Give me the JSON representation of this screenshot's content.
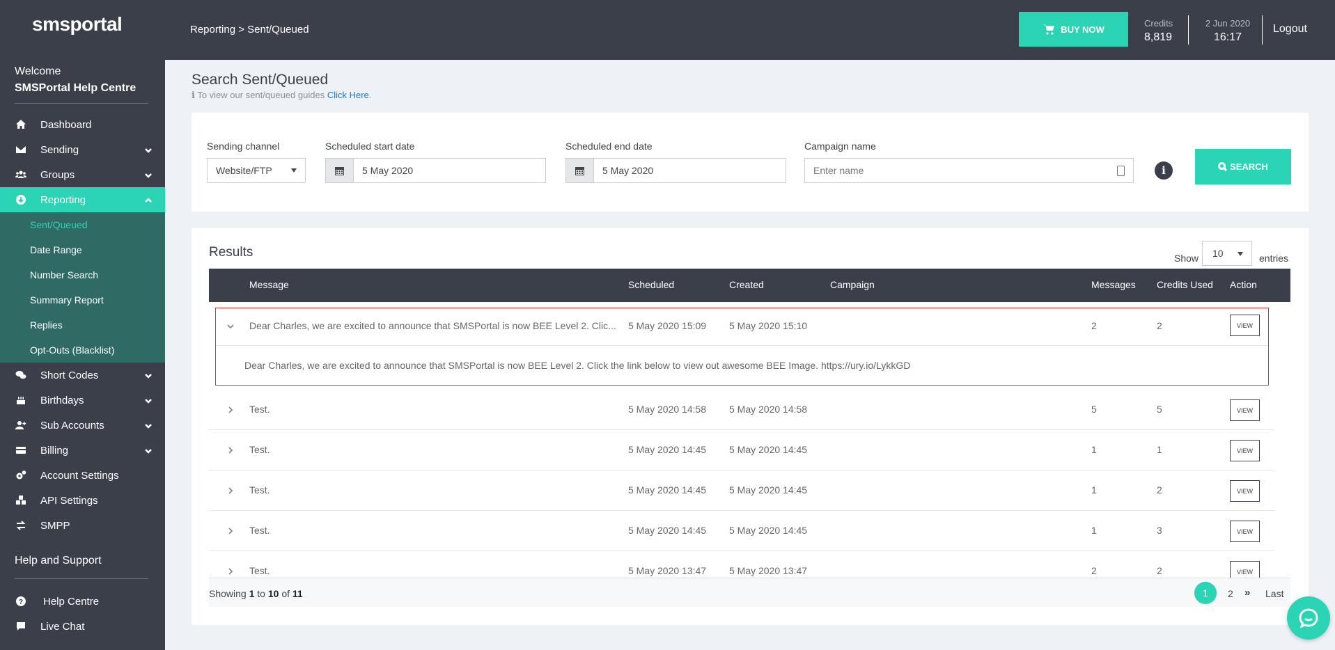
{
  "brand": {
    "logo_text_pre": "sms",
    "logo_text_post": "portal",
    "accent": "#2bd4b4",
    "dark": "#3b3f4a"
  },
  "sidebar": {
    "welcome": "Welcome",
    "account": "SMSPortal Help Centre",
    "items": [
      {
        "label": "Dashboard",
        "icon": "home-icon",
        "has_chevron": false
      },
      {
        "label": "Sending",
        "icon": "envelope-icon",
        "has_chevron": true
      },
      {
        "label": "Groups",
        "icon": "users-icon",
        "has_chevron": true
      },
      {
        "label": "Reporting",
        "icon": "download-icon",
        "has_chevron": true,
        "active": true
      }
    ],
    "reporting_sub": [
      "Sent/Queued",
      "Date Range",
      "Number Search",
      "Summary Report",
      "Replies",
      "Opt-Outs (Blacklist)"
    ],
    "items_after": [
      {
        "label": "Short Codes",
        "icon": "comments-icon",
        "has_chevron": true
      },
      {
        "label": "Birthdays",
        "icon": "cake-icon",
        "has_chevron": true
      },
      {
        "label": "Sub Accounts",
        "icon": "user-plus-icon",
        "has_chevron": true
      },
      {
        "label": "Billing",
        "icon": "credit-card-icon",
        "has_chevron": true
      },
      {
        "label": "Account Settings",
        "icon": "cogs-icon",
        "has_chevron": false
      },
      {
        "label": "API Settings",
        "icon": "cubes-icon",
        "has_chevron": false
      },
      {
        "label": "SMPP",
        "icon": "exchange-icon",
        "has_chevron": false
      }
    ],
    "help_heading": "Help and Support",
    "help_items": [
      {
        "label": "Help Centre",
        "icon": "question-circle-icon"
      },
      {
        "label": "Live Chat",
        "icon": "chat-icon"
      }
    ]
  },
  "topbar": {
    "breadcrumb": "Reporting > Sent/Queued",
    "buy_now": "BUY NOW",
    "credits_label": "Credits",
    "credits_value": "8,819",
    "date": "2 Jun 2020",
    "time": "16:17",
    "logout": "Logout"
  },
  "page": {
    "title": "Search Sent/Queued",
    "guide_text": "To view our sent/queued guides",
    "guide_link": "Click Here",
    "guide_dot": "."
  },
  "filters": {
    "channel_label": "Sending channel",
    "channel_value": "Website/FTP",
    "start_label": "Scheduled start date",
    "start_value": "5 May 2020",
    "end_label": "Scheduled end date",
    "end_value": "5 May 2020",
    "campaign_label": "Campaign name",
    "campaign_placeholder": "Enter name",
    "search_button": "SEARCH"
  },
  "results": {
    "title": "Results",
    "show_label": "Show",
    "show_value": "10",
    "entries_label": "entries",
    "columns": [
      "Message",
      "Scheduled",
      "Created",
      "Campaign",
      "Messages",
      "Credits Used",
      "Action"
    ],
    "view_label": "VIEW",
    "expanded_full_message": "Dear Charles, we are excited to announce that SMSPortal is now BEE Level 2. Click the link below to view out awesome BEE Image. https://ury.io/LykkGD",
    "rows": [
      {
        "message": "Dear Charles, we are excited to announce that SMSPortal is now BEE Level 2. Clic...",
        "scheduled": "5 May 2020 15:09",
        "created": "5 May 2020 15:10",
        "campaign": "",
        "messages": "2",
        "credits": "2",
        "expanded": true
      },
      {
        "message": "Test.",
        "scheduled": "5 May 2020 14:58",
        "created": "5 May 2020 14:58",
        "campaign": "",
        "messages": "5",
        "credits": "5"
      },
      {
        "message": "Test.",
        "scheduled": "5 May 2020 14:45",
        "created": "5 May 2020 14:45",
        "campaign": "",
        "messages": "1",
        "credits": "1"
      },
      {
        "message": "Test.",
        "scheduled": "5 May 2020 14:45",
        "created": "5 May 2020 14:45",
        "campaign": "",
        "messages": "1",
        "credits": "2"
      },
      {
        "message": "Test.",
        "scheduled": "5 May 2020 14:45",
        "created": "5 May 2020 14:45",
        "campaign": "",
        "messages": "1",
        "credits": "3"
      },
      {
        "message": "Test.",
        "scheduled": "5 May 2020 13:47",
        "created": "5 May 2020 13:47",
        "campaign": "",
        "messages": "2",
        "credits": "2"
      }
    ],
    "footer": {
      "showing": "Showing",
      "from": "1",
      "to_word": "to",
      "to": "10",
      "of_word": "of",
      "total": "11"
    },
    "pagination": {
      "current": "1",
      "next_page": "2",
      "next_icon": "»",
      "last": "Last"
    }
  }
}
